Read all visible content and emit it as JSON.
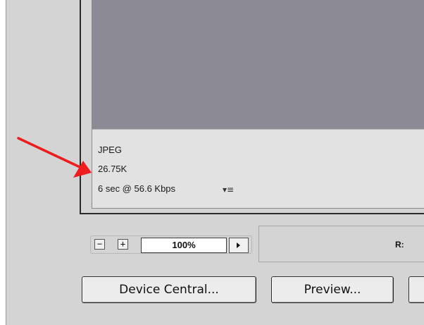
{
  "optimized_info": {
    "format": "JPEG",
    "file_size": "26.75K",
    "download_time": "6 sec @ 56.6 Kbps",
    "menu_icon": "dropdown-menu-icon"
  },
  "zoom": {
    "minus_label": "−",
    "plus_label": "+",
    "value": "100%"
  },
  "color_readout": {
    "r_label": "R:"
  },
  "buttons": {
    "device_central": "Device Central...",
    "preview": "Preview..."
  },
  "colors": {
    "annotation_arrow": "#ee1c1c",
    "preview_area": "#8b8a95",
    "panel_bg": "#d4d4d4"
  }
}
